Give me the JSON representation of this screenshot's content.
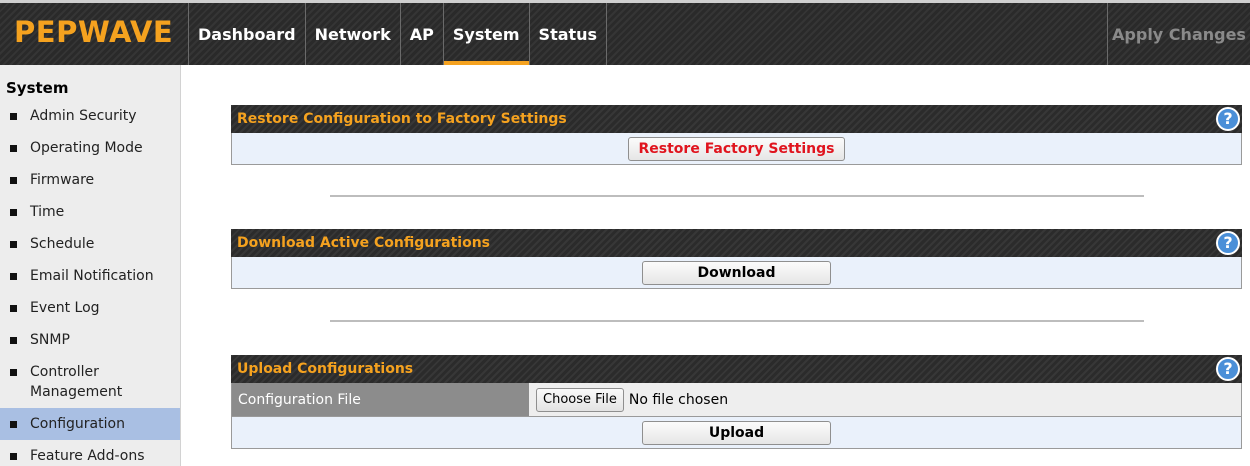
{
  "app": {
    "logo": "PEPWAVE",
    "apply_label": "Apply Changes"
  },
  "nav": {
    "tabs": [
      {
        "label": "Dashboard"
      },
      {
        "label": "Network"
      },
      {
        "label": "AP"
      },
      {
        "label": "System"
      },
      {
        "label": "Status"
      }
    ],
    "active": "System"
  },
  "sidebar": {
    "title": "System",
    "items": [
      {
        "label": "Admin Security"
      },
      {
        "label": "Operating Mode"
      },
      {
        "label": "Firmware"
      },
      {
        "label": "Time"
      },
      {
        "label": "Schedule"
      },
      {
        "label": "Email Notification"
      },
      {
        "label": "Event Log"
      },
      {
        "label": "SNMP"
      },
      {
        "label": "Controller Management"
      },
      {
        "label": "Configuration"
      },
      {
        "label": "Feature Add-ons"
      }
    ],
    "active": "Configuration"
  },
  "restore": {
    "title": "Restore Configuration to Factory Settings",
    "button": "Restore Factory Settings"
  },
  "download": {
    "title": "Download Active Configurations",
    "button": "Download"
  },
  "upload": {
    "title": "Upload Configurations",
    "file_label": "Configuration File",
    "choose_button": "Choose File",
    "file_status": "No file chosen",
    "button": "Upload"
  },
  "icons": {
    "help": "?"
  },
  "colors": {
    "accent": "#f5a21f",
    "active_item": "#a9bfe3",
    "restore_text": "#e0141e"
  }
}
